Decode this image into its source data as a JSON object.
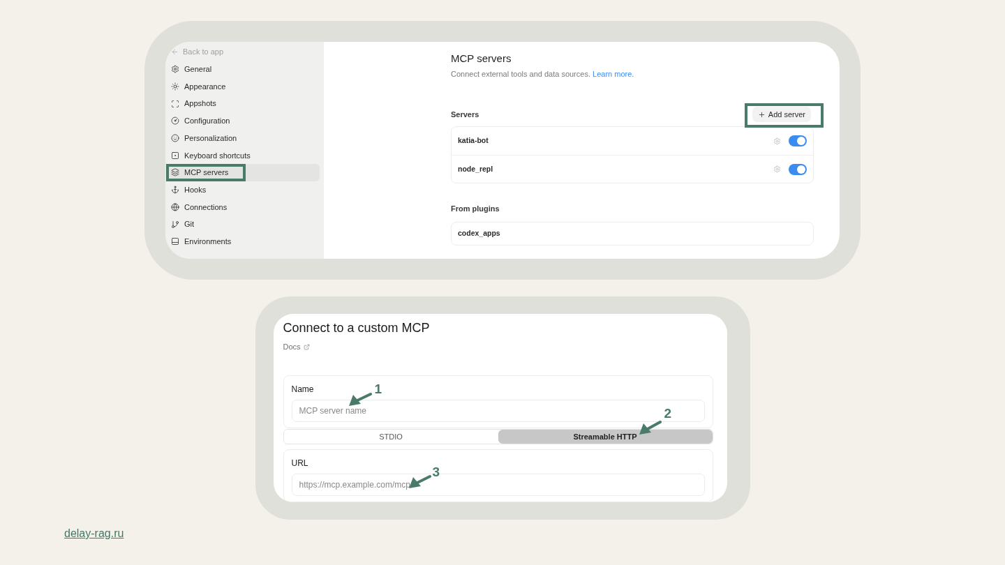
{
  "settings_window": {
    "sidebar": {
      "back_link": "Back to app",
      "items": [
        {
          "label": "General",
          "selected": false,
          "highlighted": false
        },
        {
          "label": "Appearance",
          "selected": false,
          "highlighted": false
        },
        {
          "label": "Appshots",
          "selected": false,
          "highlighted": false
        },
        {
          "label": "Configuration",
          "selected": false,
          "highlighted": false
        },
        {
          "label": "Personalization",
          "selected": false,
          "highlighted": false
        },
        {
          "label": "Keyboard shortcuts",
          "selected": false,
          "highlighted": false
        },
        {
          "label": "MCP servers",
          "selected": true,
          "highlighted": true
        },
        {
          "label": "Hooks",
          "selected": false,
          "highlighted": false
        },
        {
          "label": "Connections",
          "selected": false,
          "highlighted": false
        },
        {
          "label": "Git",
          "selected": false,
          "highlighted": false
        },
        {
          "label": "Environments",
          "selected": false,
          "highlighted": false
        }
      ]
    },
    "page": {
      "title": "MCP servers",
      "subtitle": "Connect external tools and data sources.",
      "learn_more_link": "Learn more.",
      "servers_heading": "Servers",
      "add_server_button": {
        "label": "Add server",
        "highlighted": true
      },
      "servers": [
        {
          "name": "katia-bot",
          "on": true
        },
        {
          "name": "node_repl",
          "on": true
        }
      ],
      "plugins_heading": "From plugins",
      "plugins": [
        {
          "name": "codex_apps"
        }
      ]
    }
  },
  "custom_mcp_dialog": {
    "title": "Connect to a custom MCP",
    "docs_link": "Docs",
    "name_field": {
      "label": "Name",
      "placeholder": "MCP server name"
    },
    "transport_tabs": [
      {
        "label": "STDIO",
        "selected": false
      },
      {
        "label": "Streamable HTTP",
        "selected": true
      }
    ],
    "url_field": {
      "label": "URL",
      "placeholder": "https://mcp.example.com/mcp"
    },
    "callouts": [
      {
        "number": "1"
      },
      {
        "number": "2"
      },
      {
        "number": "3"
      }
    ]
  },
  "footer_link": "delay-rag.ru"
}
